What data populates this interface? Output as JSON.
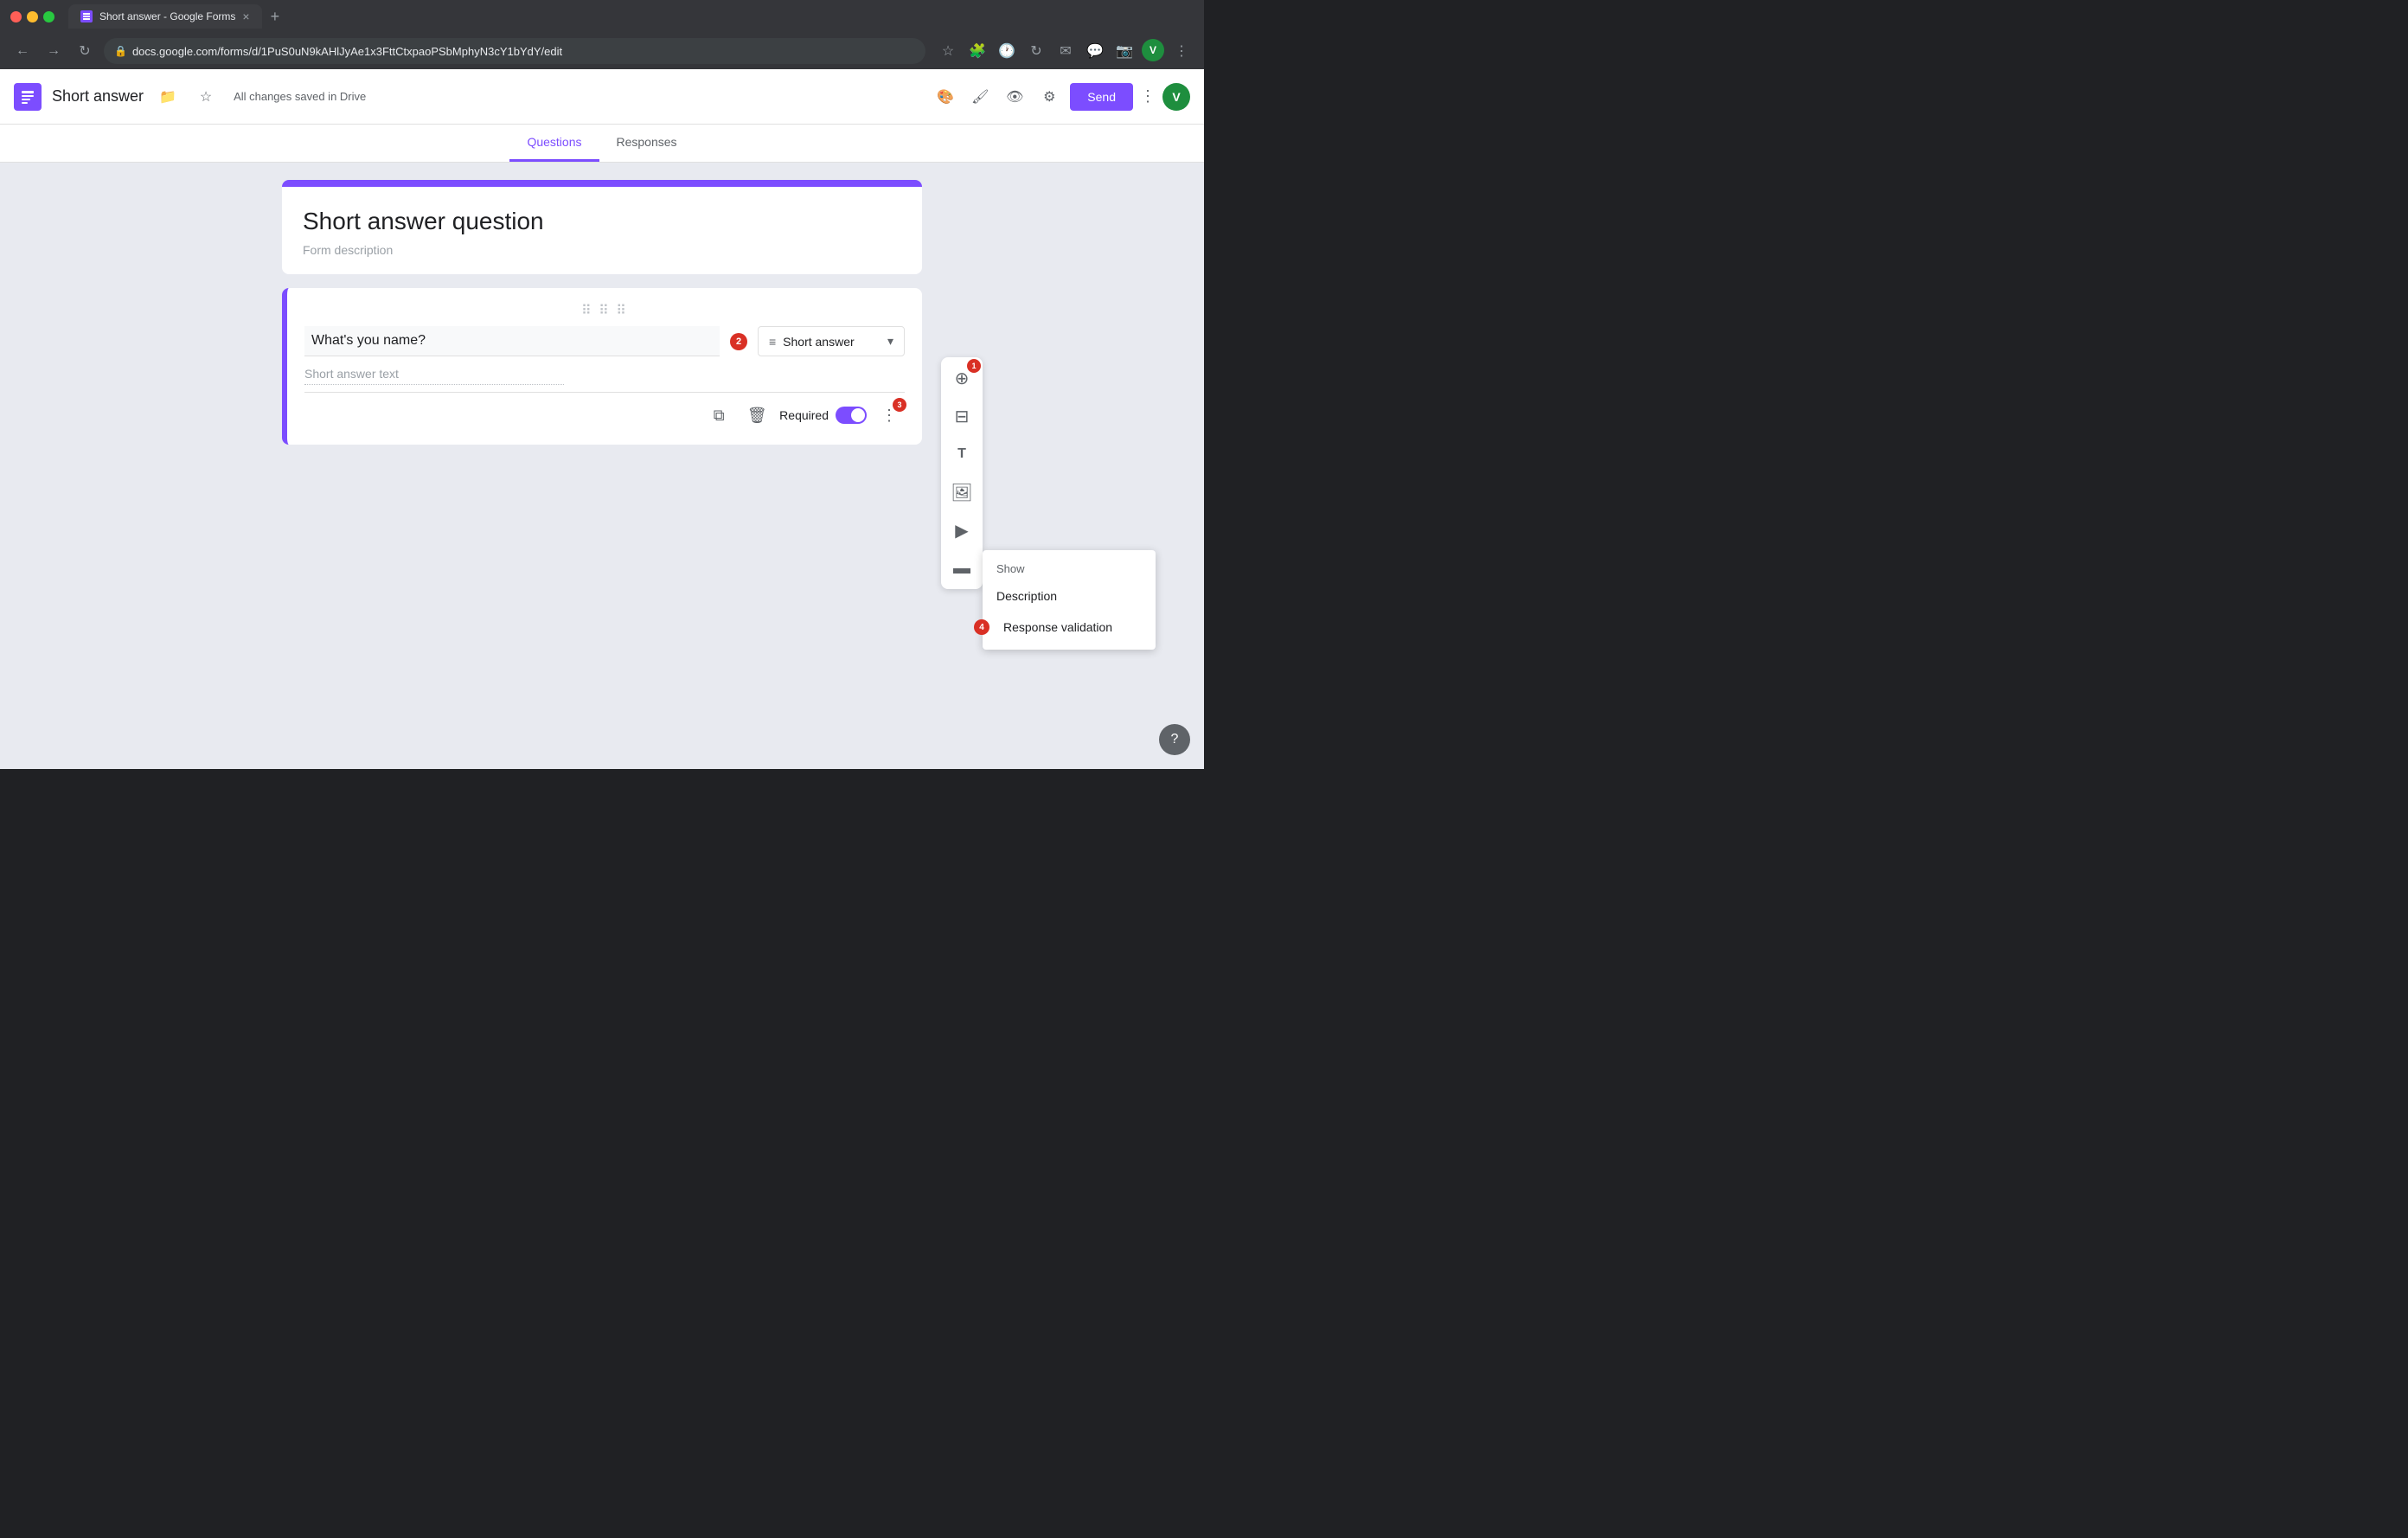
{
  "browser": {
    "tab_title": "Short answer - Google Forms",
    "tab_close": "×",
    "new_tab": "+",
    "url": "docs.google.com/forms/d/1PuS0uN9kAHlJyAe1x3FttCtxpaoPSbMphyN3cY1bYdY/edit",
    "nav_back": "←",
    "nav_forward": "→",
    "nav_refresh": "↻"
  },
  "header": {
    "form_title": "Short answer",
    "save_status": "All changes saved in Drive",
    "send_label": "Send",
    "user_initial": "V"
  },
  "tabs": {
    "questions_label": "Questions",
    "responses_label": "Responses"
  },
  "form": {
    "title": "Short answer question",
    "description_placeholder": "Form description"
  },
  "question": {
    "text": "What's you name?",
    "type": "Short answer",
    "answer_placeholder": "Short answer text",
    "required_label": "Required",
    "badge_q": "2"
  },
  "toolbar": {
    "add_icon": "+",
    "copy_section_icon": "⊞",
    "text_icon": "T",
    "image_icon": "🖼",
    "video_icon": "▶",
    "section_icon": "▬",
    "badge_1": "1"
  },
  "actions": {
    "copy_icon": "⧉",
    "delete_icon": "🗑",
    "more_icon": "⋮",
    "badge_3": "3"
  },
  "context_menu": {
    "show_label": "Show",
    "description_item": "Description",
    "response_validation_item": "Response validation",
    "badge_4": "4"
  },
  "help": {
    "icon": "?"
  }
}
